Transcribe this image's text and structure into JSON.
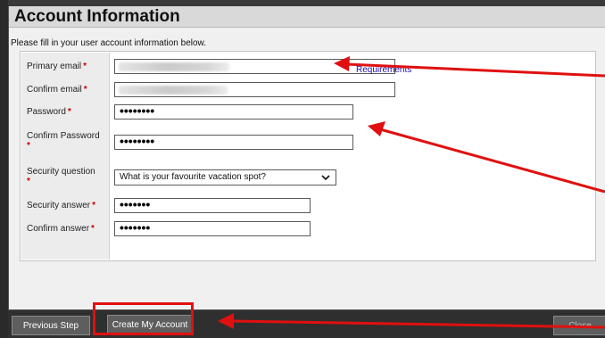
{
  "dialog": {
    "title": "Account Information",
    "instructions": "Please fill in your user account information below."
  },
  "form": {
    "required_marker": "*",
    "primary_email": {
      "label": "Primary email",
      "value": "",
      "obscured": true
    },
    "confirm_email": {
      "label": "Confirm email",
      "value": "",
      "obscured": true
    },
    "password": {
      "label": "Password",
      "masked_value": "••••••••"
    },
    "requirements_link": "Requirements",
    "confirm_password": {
      "label": "Confirm Password",
      "masked_value": "••••••••"
    },
    "security_question": {
      "label": "Security question",
      "selected": "What is your favourite vacation spot?",
      "icon": "chevron-down-icon"
    },
    "security_answer": {
      "label": "Security answer",
      "masked_value": "•••••••"
    },
    "confirm_answer": {
      "label": "Confirm answer",
      "masked_value": "•••••••"
    }
  },
  "footer": {
    "previous_label": "Previous Step",
    "create_label": "Create My Account",
    "close_label": "Close"
  },
  "annotations": {
    "highlight_color": "#e01010",
    "arrow_color": "#e01010"
  }
}
